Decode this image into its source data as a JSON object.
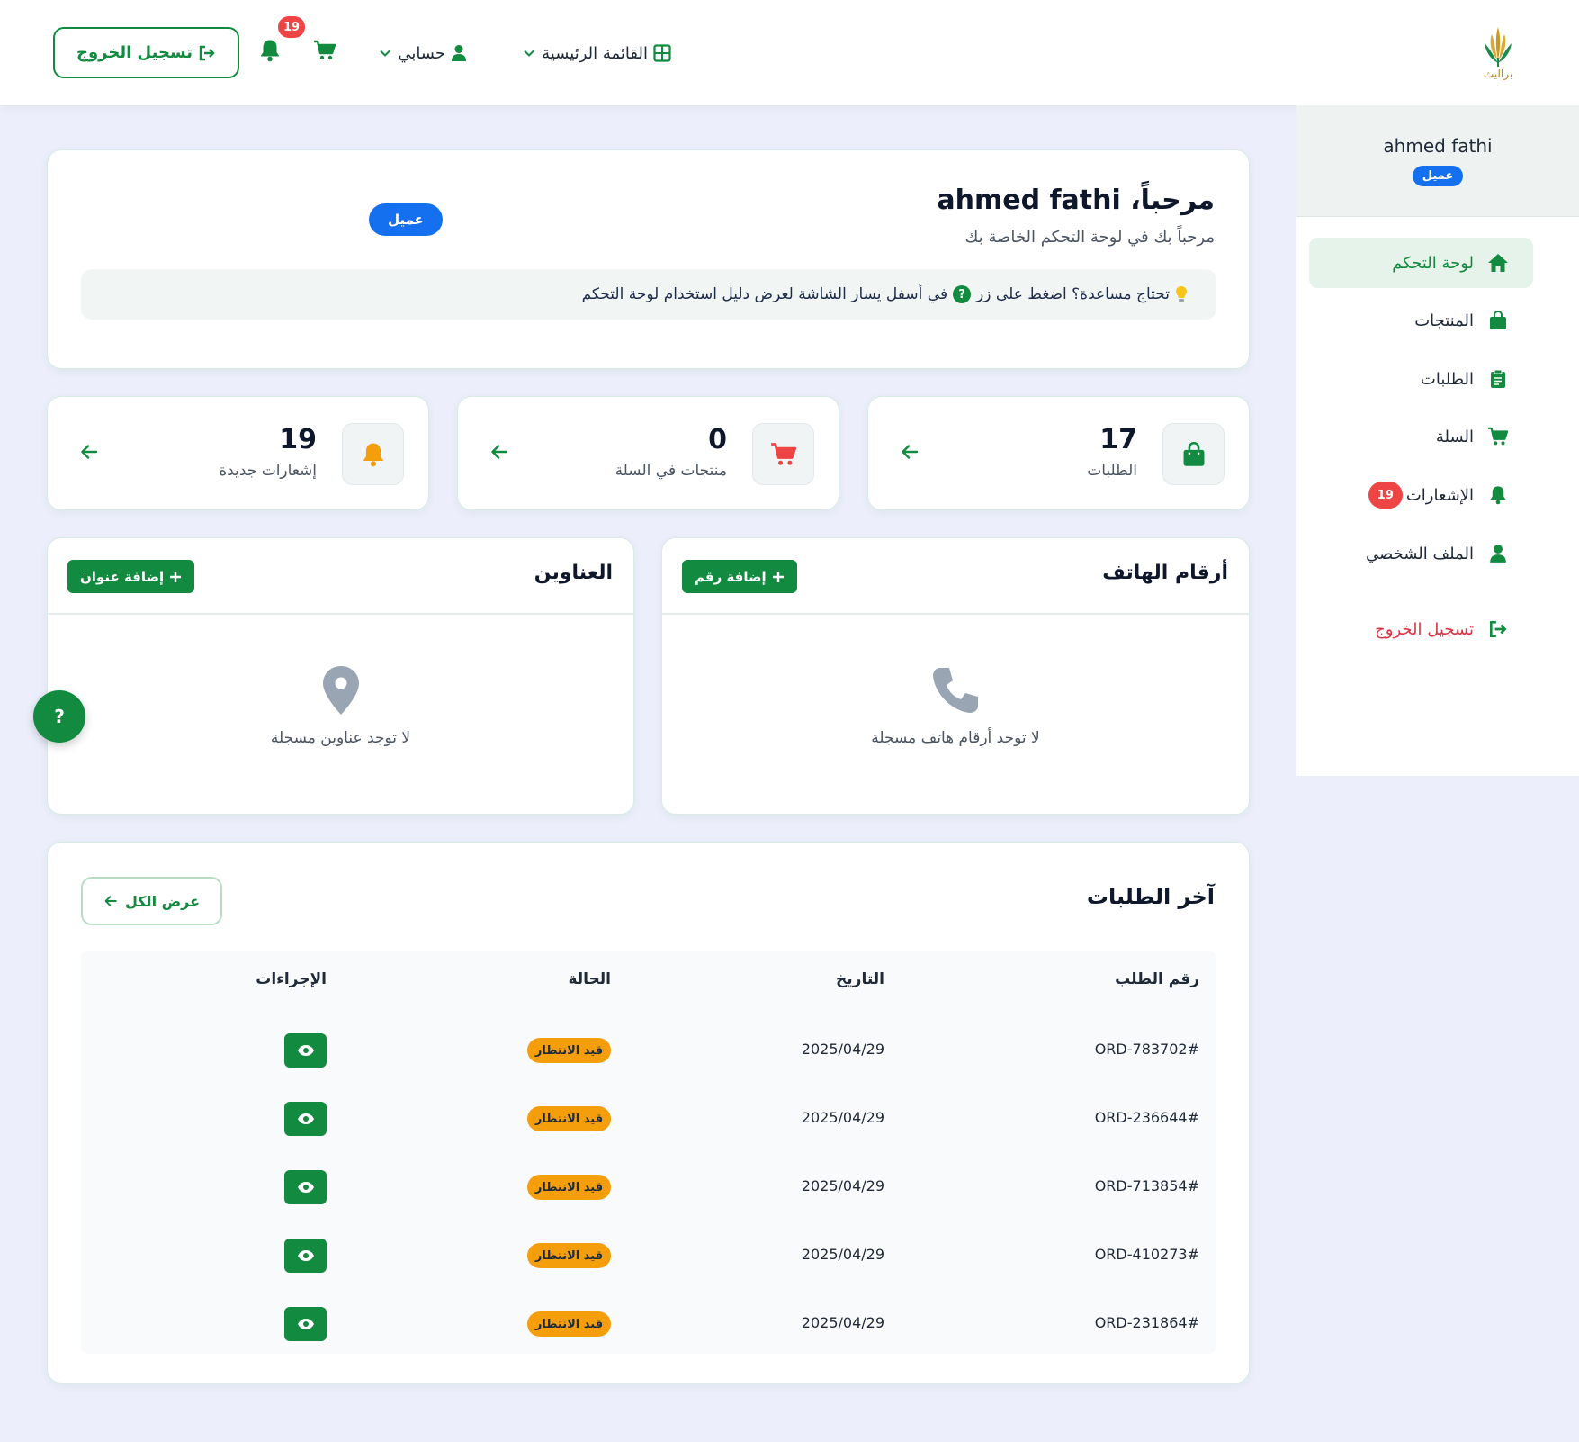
{
  "header": {
    "logo_text": "براليث",
    "logout_label": "تسجيل الخروج",
    "notification_count": "19",
    "account_label": "حسابي",
    "main_menu_label": "القائمة الرئيسية"
  },
  "sidebar": {
    "user_name": "ahmed fathi",
    "role_badge": "عميل",
    "items": [
      {
        "label": "لوحة التحكم",
        "icon": "home-icon",
        "active": true
      },
      {
        "label": "المنتجات",
        "icon": "shopping-bag-icon"
      },
      {
        "label": "الطلبات",
        "icon": "clipboard-icon"
      },
      {
        "label": "السلة",
        "icon": "cart-icon"
      },
      {
        "label": "الإشعارات",
        "icon": "bell-icon",
        "badge": "19"
      },
      {
        "label": "الملف الشخصي",
        "icon": "user-icon"
      },
      {
        "label": "تسجيل الخروج",
        "icon": "logout-icon"
      }
    ]
  },
  "welcome": {
    "title": "مرحباً، ahmed fathi",
    "subtitle": "مرحباً بك في لوحة التحكم الخاصة بك",
    "role_badge": "عميل",
    "help_before": "تحتاج مساعدة؟ اضغط على زر",
    "help_question_mark": "?",
    "help_after": "في أسفل يسار الشاشة لعرض دليل استخدام لوحة التحكم"
  },
  "stats": [
    {
      "value": "17",
      "label": "الطلبات",
      "icon": "shopping-bag-icon"
    },
    {
      "value": "0",
      "label": "منتجات في السلة",
      "icon": "cart-icon"
    },
    {
      "value": "19",
      "label": "إشعارات جديدة",
      "icon": "bell-icon"
    }
  ],
  "phones": {
    "title": "أرقام الهاتف",
    "add_label": "إضافة رقم",
    "empty_text": "لا توجد أرقام هاتف مسجلة"
  },
  "addresses": {
    "title": "العناوين",
    "add_label": "إضافة عنوان",
    "empty_text": "لا توجد عناوين مسجلة"
  },
  "help_fab": "?",
  "orders": {
    "title": "آخر الطلبات",
    "view_all_label": "عرض الكل",
    "columns": [
      "رقم الطلب",
      "التاريخ",
      "الحالة",
      "الإجراءات"
    ],
    "rows": [
      {
        "id": "#ORD-783702",
        "date": "2025/04/29",
        "status": "قيد الانتظار"
      },
      {
        "id": "#ORD-236644",
        "date": "2025/04/29",
        "status": "قيد الانتظار"
      },
      {
        "id": "#ORD-713854",
        "date": "2025/04/29",
        "status": "قيد الانتظار"
      },
      {
        "id": "#ORD-410273",
        "date": "2025/04/29",
        "status": "قيد الانتظار"
      },
      {
        "id": "#ORD-231864",
        "date": "2025/04/29",
        "status": "قيد الانتظار"
      }
    ]
  },
  "colors": {
    "primary": "#128a3f",
    "danger": "#dc3545",
    "badge_red": "#ef4444",
    "role_blue": "#1570ef",
    "status_pending": "#f59e0b",
    "background": "#eceffb"
  }
}
